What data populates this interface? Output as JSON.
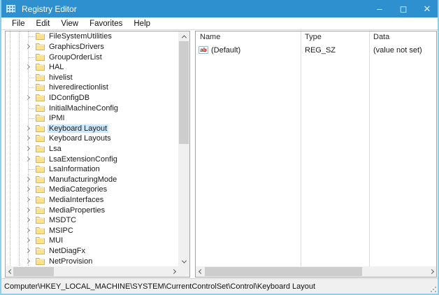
{
  "window": {
    "title": "Registry Editor",
    "controls": {
      "minimize": "–",
      "maximize": "◻",
      "close": "✕"
    }
  },
  "menu": {
    "items": [
      "File",
      "Edit",
      "View",
      "Favorites",
      "Help"
    ]
  },
  "tree": {
    "items": [
      {
        "label": "FileSystemUtilities",
        "expander": false,
        "selected": false
      },
      {
        "label": "GraphicsDrivers",
        "expander": true,
        "selected": false
      },
      {
        "label": "GroupOrderList",
        "expander": false,
        "selected": false
      },
      {
        "label": "HAL",
        "expander": true,
        "selected": false
      },
      {
        "label": "hivelist",
        "expander": false,
        "selected": false
      },
      {
        "label": "hiveredirectionlist",
        "expander": false,
        "selected": false
      },
      {
        "label": "IDConfigDB",
        "expander": true,
        "selected": false
      },
      {
        "label": "InitialMachineConfig",
        "expander": false,
        "selected": false
      },
      {
        "label": "IPMI",
        "expander": false,
        "selected": false
      },
      {
        "label": "Keyboard Layout",
        "expander": true,
        "selected": true
      },
      {
        "label": "Keyboard Layouts",
        "expander": true,
        "selected": false
      },
      {
        "label": "Lsa",
        "expander": true,
        "selected": false
      },
      {
        "label": "LsaExtensionConfig",
        "expander": true,
        "selected": false
      },
      {
        "label": "LsaInformation",
        "expander": false,
        "selected": false
      },
      {
        "label": "ManufacturingMode",
        "expander": true,
        "selected": false
      },
      {
        "label": "MediaCategories",
        "expander": true,
        "selected": false
      },
      {
        "label": "MediaInterfaces",
        "expander": true,
        "selected": false
      },
      {
        "label": "MediaProperties",
        "expander": true,
        "selected": false
      },
      {
        "label": "MSDTC",
        "expander": true,
        "selected": false
      },
      {
        "label": "MSIPC",
        "expander": true,
        "selected": false
      },
      {
        "label": "MUI",
        "expander": true,
        "selected": false
      },
      {
        "label": "NetDiagFx",
        "expander": true,
        "selected": false
      },
      {
        "label": "NetProvision",
        "expander": true,
        "selected": false
      }
    ]
  },
  "list": {
    "columns": [
      "Name",
      "Type",
      "Data"
    ],
    "value_icon_label": "ab",
    "rows": [
      {
        "name": "(Default)",
        "type": "REG_SZ",
        "data": "(value not set)"
      }
    ]
  },
  "statusbar": {
    "path": "Computer\\HKEY_LOCAL_MACHINE\\SYSTEM\\CurrentControlSet\\Control\\Keyboard Layout"
  },
  "colors": {
    "titlebar_bg": "#2e90cf",
    "titlebar_text": "#ffffff",
    "window_border": "#8fd0ef",
    "selection_bg": "#cde8fa",
    "pane_border": "#a3a3a3",
    "folder_fill": "#fbe38d",
    "folder_stroke": "#c9a14a",
    "scroll_track": "#f0f0f0",
    "scroll_thumb": "#cdcdcd",
    "status_bg": "#f0f0f0",
    "value_icon_red": "#c00000"
  }
}
